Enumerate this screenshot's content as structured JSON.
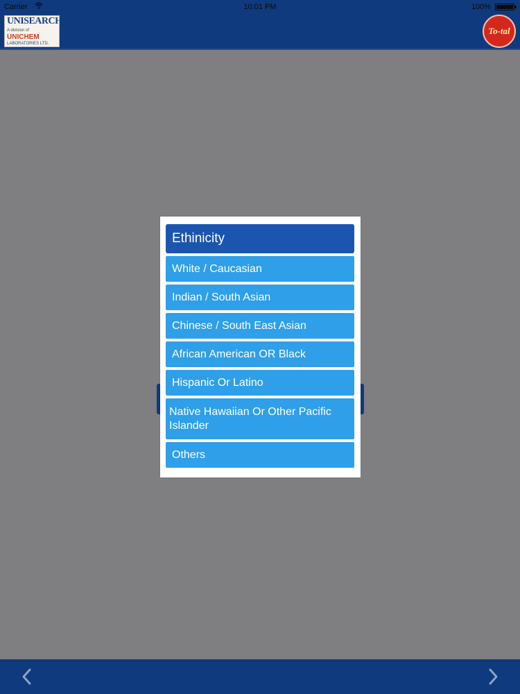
{
  "status_bar": {
    "carrier": "Carrier",
    "time": "10:01 PM",
    "battery": "100%",
    "wifi_icon": "wifi-icon",
    "battery_icon": "battery-icon"
  },
  "header": {
    "left_logo": {
      "line1": "UNISEARCH",
      "line2": "A division of",
      "line3": "UNICHEM",
      "line4": "LABORATORIES LTD."
    },
    "right_logo": {
      "text": "To-tal"
    }
  },
  "modal": {
    "title": "Ethinicity",
    "options": [
      "White / Caucasian",
      "Indian / South Asian",
      "Chinese / South East Asian",
      "African American OR Black",
      "Hispanic Or Latino",
      "Native Hawaiian Or Other Pacific Islander",
      "Others"
    ]
  },
  "footer": {
    "prev_icon": "chevron-left-icon",
    "next_icon": "chevron-right-icon"
  },
  "colors": {
    "header_bg": "#0f3a7d",
    "overlay_bg": "#7f7e80",
    "title_bg": "#1b55b0",
    "option_bg": "#2e9fe8"
  }
}
